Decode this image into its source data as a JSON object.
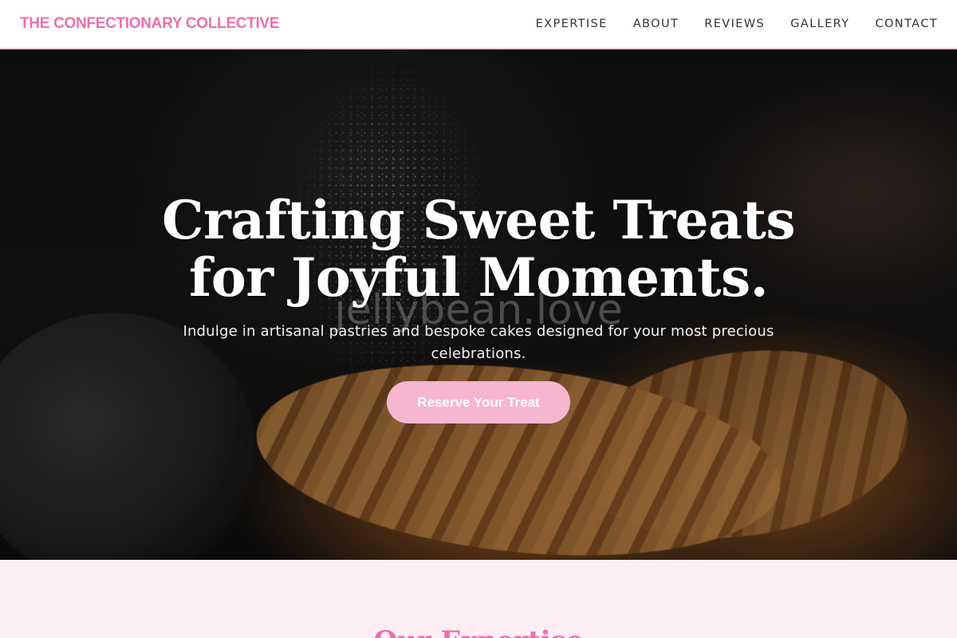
{
  "header": {
    "brand": "THE CONFECTIONARY COLLECTIVE",
    "nav": [
      {
        "label": "EXPERTISE"
      },
      {
        "label": "ABOUT"
      },
      {
        "label": "REVIEWS"
      },
      {
        "label": "GALLERY"
      },
      {
        "label": "CONTACT"
      }
    ]
  },
  "hero": {
    "title": "Crafting Sweet Treats for Joyful Moments.",
    "subtitle": "Indulge in artisanal pastries and bespoke cakes designed for your most precious celebrations.",
    "cta_label": "Reserve Your Treat",
    "watermark": "jellybean.love"
  },
  "expertise": {
    "title": "Our Expertise"
  },
  "colors": {
    "brand_pink": "#ee6fad",
    "button_pink": "#f7b6d0",
    "section_bg": "#fdeef3"
  }
}
